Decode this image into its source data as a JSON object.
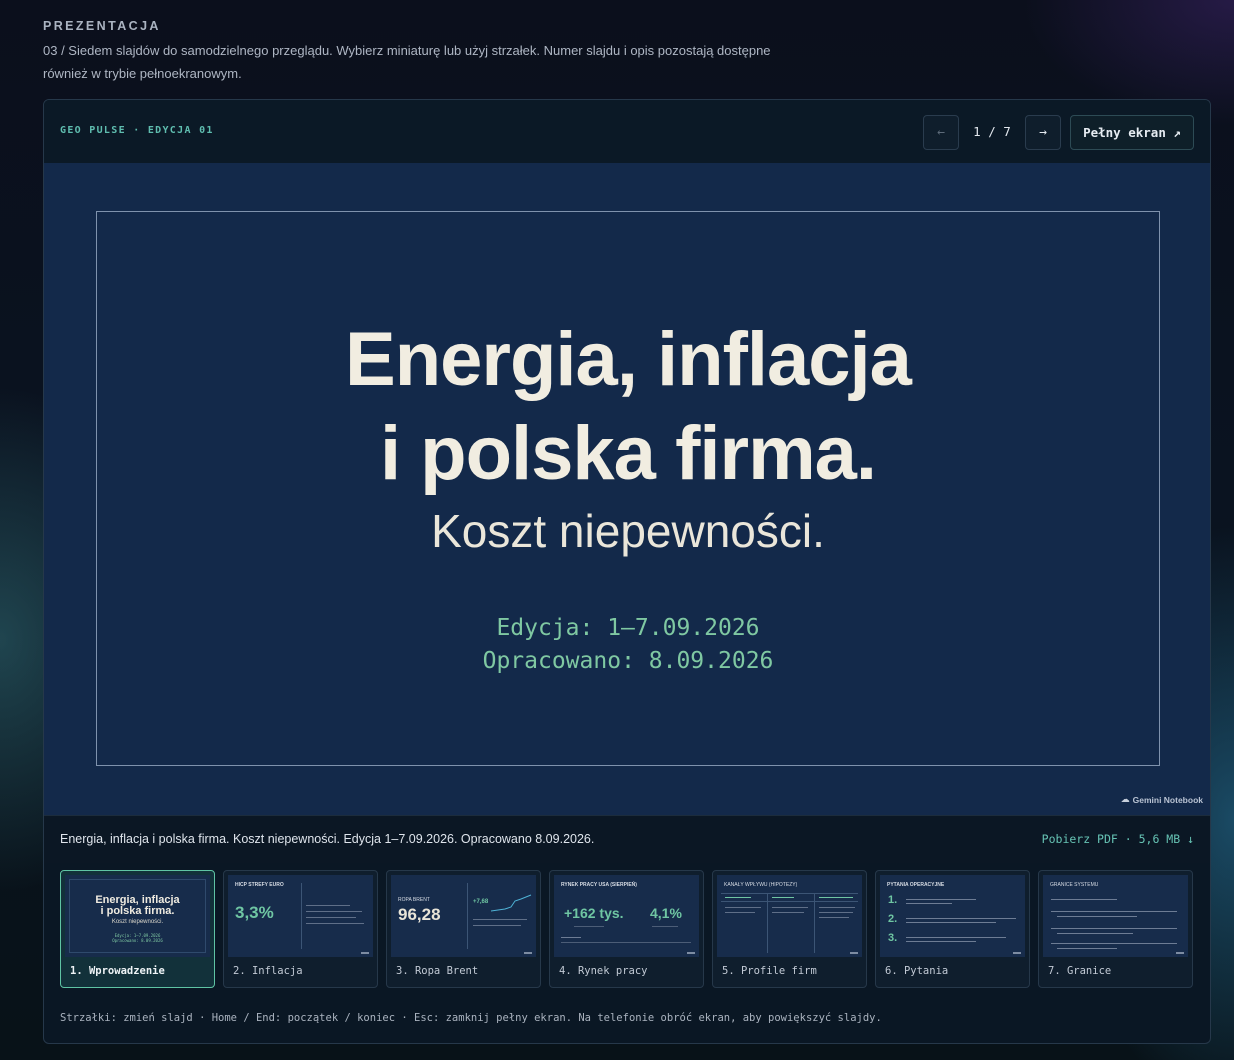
{
  "section": {
    "label": "PREZENTACJA",
    "intro": "03 / Siedem slajdów do samodzielnego przeglądu. Wybierz miniaturę lub użyj strzałek. Numer slajdu i opis pozostają dostępne również w trybie pełnoekranowym."
  },
  "viewer": {
    "kicker": "GEO PULSE · EDYCJA 01",
    "prev_icon": "←",
    "next_icon": "→",
    "counter": "1 / 7",
    "fullscreen_label": "Pełny ekran ↗"
  },
  "slide": {
    "title_line1": "Energia, inflacja",
    "title_line2": "i polska firma.",
    "subtitle": "Koszt niepewności.",
    "edition": "Edycja: 1–7.09.2026",
    "prepared": "Opracowano: 8.09.2026",
    "watermark": "Gemini Notebook"
  },
  "caption": {
    "text": "Energia, inflacja i polska firma. Koszt niepewności. Edycja 1–7.09.2026. Opracowano 8.09.2026.",
    "pdf_link": "Pobierz PDF · 5,6 MB ↓"
  },
  "thumbnails": [
    {
      "label": "1. Wprowadzenie",
      "title_line1": "Energia, inflacja",
      "title_line2": "i polska firma.",
      "subtitle": "Koszt niepewności.",
      "meta_line1": "Edycja: 1–7.09.2026",
      "meta_line2": "Opracowano: 8.09.2026"
    },
    {
      "label": "2. Inflacja",
      "heading": "HICP STREFY EURO",
      "value": "3,3%"
    },
    {
      "label": "3. Ropa Brent",
      "heading": "ROPA BRENT",
      "value": "96,28",
      "side_value": "+7,68"
    },
    {
      "label": "4. Rynek pracy",
      "heading": "RYNEK PRACY USA (SIERPIEŃ)",
      "value": "+162 tys.",
      "value2": "4,1%"
    },
    {
      "label": "5. Profile firm",
      "heading": "KANAŁY WPŁYWU (HIPOTEZY)"
    },
    {
      "label": "6. Pytania",
      "heading": "PYTANIA OPERACYJNE",
      "num1": "1.",
      "num2": "2.",
      "num3": "3."
    },
    {
      "label": "7. Granice",
      "heading": "GRANICE SYSTEMU"
    }
  ],
  "hint": "Strzałki: zmień slajd · Home / End: początek / koniec · Esc: zamknij pełny ekran. Na telefonie obróć ekran, aby powiększyć slajdy."
}
